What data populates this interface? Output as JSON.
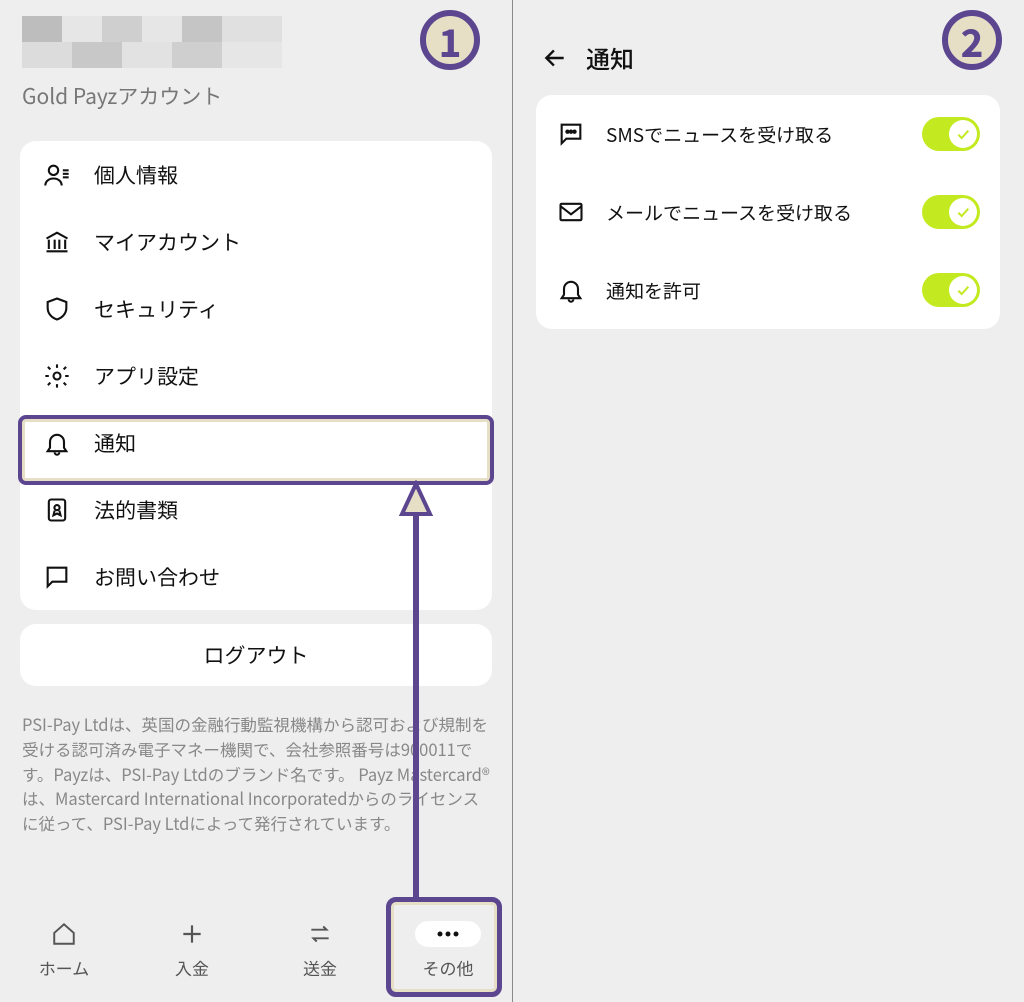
{
  "left": {
    "account_type": "Gold Payzアカウント",
    "menu": [
      {
        "label": "個人情報",
        "icon": "person"
      },
      {
        "label": "マイアカウント",
        "icon": "bank"
      },
      {
        "label": "セキュリティ",
        "icon": "shield"
      },
      {
        "label": "アプリ設定",
        "icon": "gear"
      },
      {
        "label": "通知",
        "icon": "bell"
      },
      {
        "label": "法的書類",
        "icon": "doc"
      },
      {
        "label": "お問い合わせ",
        "icon": "chat"
      }
    ],
    "logout": "ログアウト",
    "legal": "PSI-Pay Ltdは、英国の金融行動監視機構から認可および規制を受ける認可済み電子マネー機関で、会社参照番号は900011です。Payzは、PSI-Pay Ltdのブランド名です。 Payz Mastercard®は、Mastercard International Incorporatedからのライセンスに従って、PSI-Pay Ltdによって発行されています。",
    "nav": {
      "home": "ホーム",
      "deposit": "入金",
      "transfer": "送金",
      "other": "その他"
    }
  },
  "right": {
    "title": "通知",
    "settings": [
      {
        "label": "SMSでニュースを受け取る",
        "icon": "sms",
        "on": true
      },
      {
        "label": "メールでニュースを受け取る",
        "icon": "mail",
        "on": true
      },
      {
        "label": "通知を許可",
        "icon": "bell",
        "on": true
      }
    ]
  },
  "badges": {
    "one": "1",
    "two": "2"
  },
  "colors": {
    "accent": "#5b468f",
    "badge_bg": "#e6dfc6",
    "toggle_on": "#c3ea21"
  }
}
